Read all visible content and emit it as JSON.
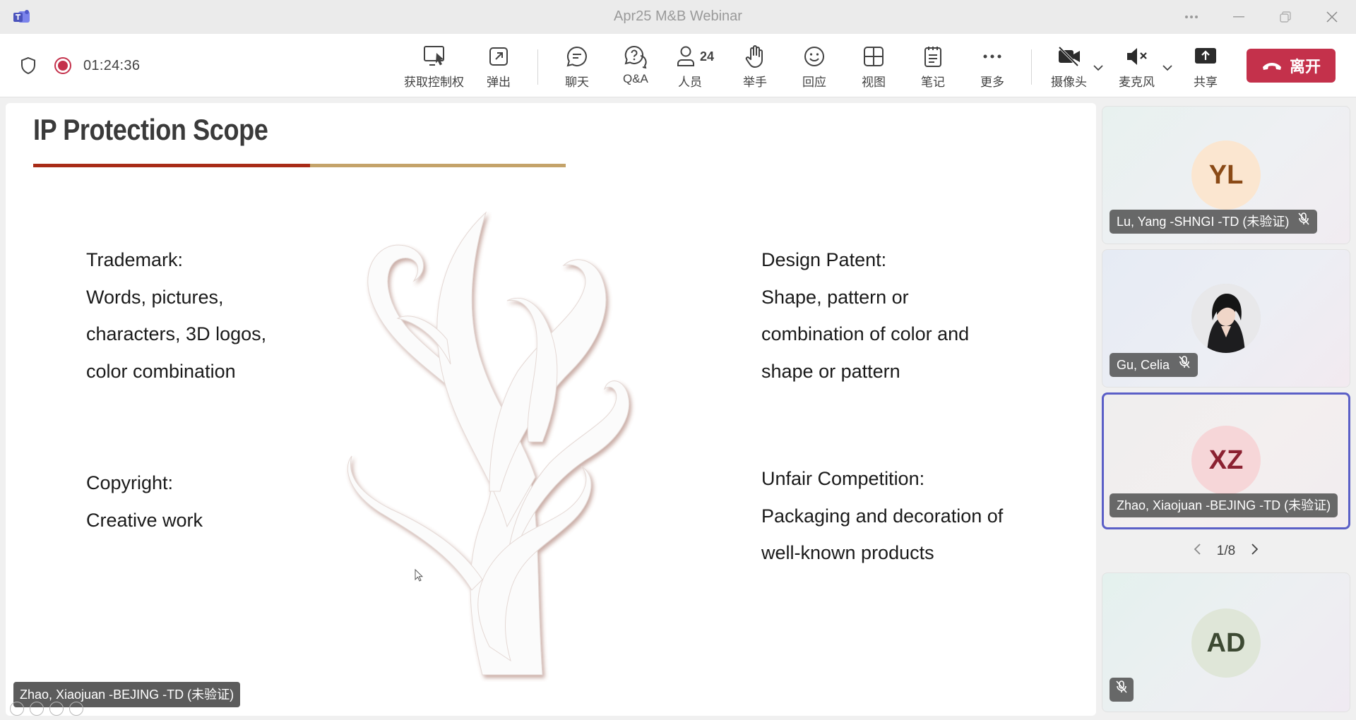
{
  "window": {
    "title": "Apr25 M&B Webinar"
  },
  "status": {
    "timer": "01:24:36"
  },
  "toolbar": {
    "take_control": "获取控制权",
    "pop_out": "弹出",
    "chat": "聊天",
    "qa": "Q&A",
    "people": "人员",
    "people_count": "24",
    "raise_hand": "举手",
    "react": "回应",
    "view": "视图",
    "notes": "笔记",
    "more": "更多",
    "camera": "摄像头",
    "mic": "麦克风",
    "share": "共享",
    "leave": "离开"
  },
  "slide": {
    "title": "IP Protection Scope",
    "trademark": [
      "Trademark:",
      "Words, pictures,",
      "characters, 3D logos,",
      "color combination"
    ],
    "copyright": [
      "Copyright:",
      "Creative work"
    ],
    "design_patent": [
      "Design Patent:",
      "Shape, pattern or",
      "combination of color and",
      "shape or pattern"
    ],
    "unfair_competition": [
      "Unfair Competition:",
      "Packaging and decoration of",
      "well-known products"
    ]
  },
  "stage_presenter": "Zhao, Xiaojuan -BEJING -TD (未验证)",
  "participants": [
    {
      "initials": "YL",
      "name": "Lu, Yang -SHNGI -TD (未验证)",
      "avatar_bg": "#fbe6d0",
      "avatar_fg": "#8a4a16"
    },
    {
      "initials": "",
      "name": "Gu, Celia",
      "avatar_bg": "#d9d9d9",
      "avatar_fg": "#333333"
    },
    {
      "initials": "XZ",
      "name": "Zhao, Xiaojuan -BEJING -TD (未验证)",
      "avatar_bg": "#f6d6d8",
      "avatar_fg": "#8b2131"
    },
    {
      "initials": "AD",
      "name": "",
      "avatar_bg": "#dfe6d8",
      "avatar_fg": "#3d4a33"
    }
  ],
  "pager": {
    "label": "1/8"
  },
  "colors": {
    "accent": "#5b5fc7",
    "leave": "#c4314b",
    "record": "#c4314b",
    "title_rule_red": "#a82b17",
    "title_rule_gold": "#c4a36a"
  }
}
